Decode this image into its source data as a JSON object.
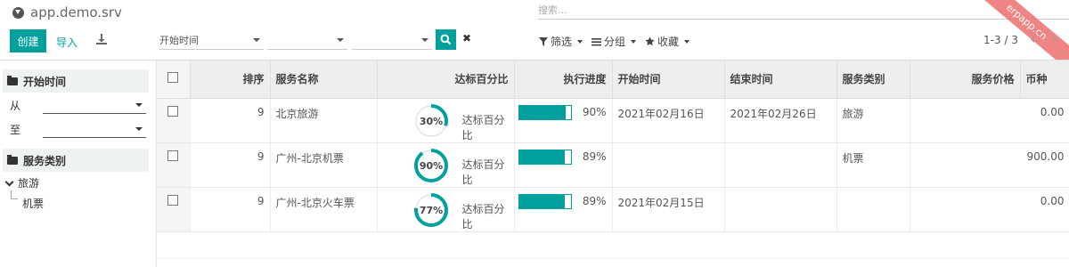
{
  "breadcrumb": {
    "title": "app.demo.srv"
  },
  "search": {
    "placeholder": "搜索..."
  },
  "ribbon": {
    "text": "erpapp.cn"
  },
  "toolbar": {
    "create": "创建",
    "import": "导入"
  },
  "filters_bar": {
    "date_select": "开始时间",
    "clear": "✖"
  },
  "facets": {
    "filter": "筛选",
    "group": "分组",
    "favorites": "收藏"
  },
  "pager": {
    "value": "1-3 / 3",
    "prev": "‹",
    "next": "›"
  },
  "side": {
    "section1": "开始时间",
    "from": "从",
    "to": "至",
    "section2": "服务类别",
    "category_parent": "旅游",
    "category_child": "机票"
  },
  "table": {
    "headers": [
      "排序",
      "服务名称",
      "达标百分比",
      "执行进度",
      "开始时间",
      "结束时间",
      "服务类别",
      "服务价格",
      "币种"
    ],
    "rows": [
      {
        "seq": "9",
        "name": "北京旅游",
        "pct": "30%",
        "pct_value": 30,
        "pct_label": "达标百分比",
        "progress": "90%",
        "progress_value": 90,
        "start": "2021年02月16日",
        "end": "2021年02月26日",
        "category": "旅游",
        "price": "0.00",
        "currency": ""
      },
      {
        "seq": "9",
        "name": "广州-北京机票",
        "pct": "90%",
        "pct_value": 90,
        "pct_label": "达标百分比",
        "progress": "89%",
        "progress_value": 89,
        "start": "",
        "end": "",
        "category": "机票",
        "price": "900.00",
        "currency": ""
      },
      {
        "seq": "9",
        "name": "广州-北京火车票",
        "pct": "77%",
        "pct_value": 77,
        "pct_label": "达标百分比",
        "progress": "89%",
        "progress_value": 89,
        "start": "2021年02月15日",
        "end": "",
        "category": "",
        "price": "0.00",
        "currency": ""
      }
    ]
  },
  "colors": {
    "accent": "#00a09d",
    "ribbon": "#ee7777"
  }
}
